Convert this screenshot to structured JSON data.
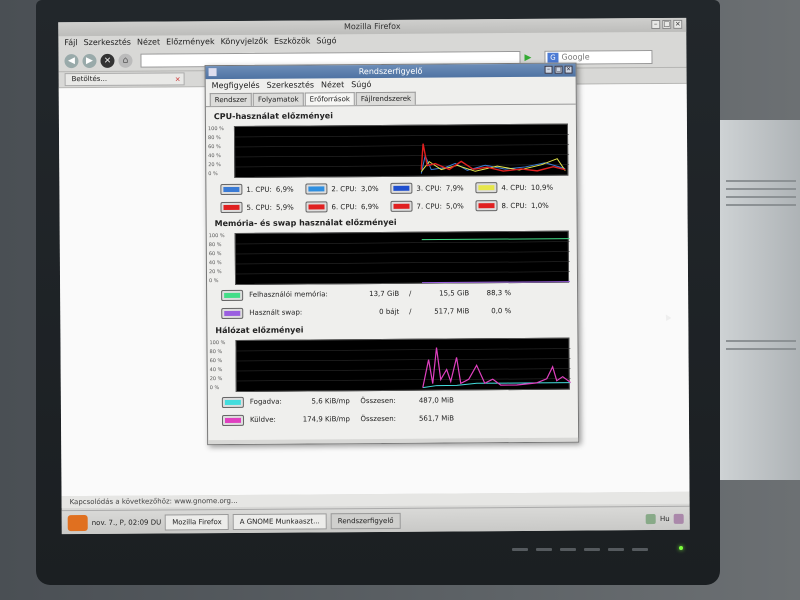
{
  "firefox": {
    "title": "Mozilla Firefox",
    "menu": [
      "Fájl",
      "Szerkesztés",
      "Nézet",
      "Előzmények",
      "Könyvjelzők",
      "Eszközök",
      "Súgó"
    ],
    "search_placeholder": "Google",
    "tab_label": "Betöltés...",
    "status": "Kapcsolódás a következőhöz: www.gnome.org..."
  },
  "system_monitor": {
    "title": "Rendszerfigyelő",
    "menu": [
      "Megfigyelés",
      "Szerkesztés",
      "Nézet",
      "Súgó"
    ],
    "tabs": [
      "Rendszer",
      "Folyamatok",
      "Erőforrások",
      "Fájlrendszerek"
    ],
    "active_tab": "Erőforrások",
    "cpu": {
      "title": "CPU-használat előzményei",
      "graph_labels": [
        "100 %",
        "80 %",
        "60 %",
        "40 %",
        "20 %",
        "0 %"
      ],
      "cores": [
        {
          "label": "1. CPU:",
          "value": "6,9%",
          "color": "#3a7bd5"
        },
        {
          "label": "2. CPU:",
          "value": "3,0%",
          "color": "#2f8fe0"
        },
        {
          "label": "3. CPU:",
          "value": "7,9%",
          "color": "#1f4fcf"
        },
        {
          "label": "4. CPU:",
          "value": "10,9%",
          "color": "#e6e64a"
        },
        {
          "label": "5. CPU:",
          "value": "5,9%",
          "color": "#e02020"
        },
        {
          "label": "6. CPU:",
          "value": "6,9%",
          "color": "#e02020"
        },
        {
          "label": "7. CPU:",
          "value": "5,0%",
          "color": "#e02020"
        },
        {
          "label": "8. CPU:",
          "value": "1,0%",
          "color": "#e02020"
        }
      ]
    },
    "memory": {
      "title": "Memória- és swap használat előzményei",
      "graph_labels": [
        "100 %",
        "80 %",
        "60 %",
        "40 %",
        "20 %",
        "0 %"
      ],
      "mem": {
        "label": "Felhasználói memória:",
        "used": "13,7 GiB",
        "sep": "/",
        "total": "15,5 GiB",
        "percent": "88,3 %",
        "color": "#44dd88"
      },
      "swap": {
        "label": "Használt swap:",
        "used": "0 bájt",
        "sep": "/",
        "total": "517,7 MiB",
        "percent": "0,0 %",
        "color": "#9a5fe0"
      }
    },
    "network": {
      "title": "Hálózat előzményei",
      "graph_labels": [
        "100 %",
        "80 %",
        "60 %",
        "40 %",
        "20 %",
        "0 %"
      ],
      "recv": {
        "label": "Fogadva:",
        "rate": "5,6 KiB/mp",
        "total_label": "Összesen:",
        "total": "487,0 MiB",
        "color": "#44dddd"
      },
      "sent": {
        "label": "Küldve:",
        "rate": "174,9 KiB/mp",
        "total_label": "Összesen:",
        "total": "561,7 MiB",
        "color": "#e040c0"
      }
    }
  },
  "panel": {
    "clock": "nov. 7., P, 02:09 DU",
    "tasks": [
      "Mozilla Firefox",
      "A GNOME Munkaaszt...",
      "Rendszerfigyelő"
    ],
    "active_task": "Rendszerfigyelő",
    "keyboard": "Hu"
  }
}
